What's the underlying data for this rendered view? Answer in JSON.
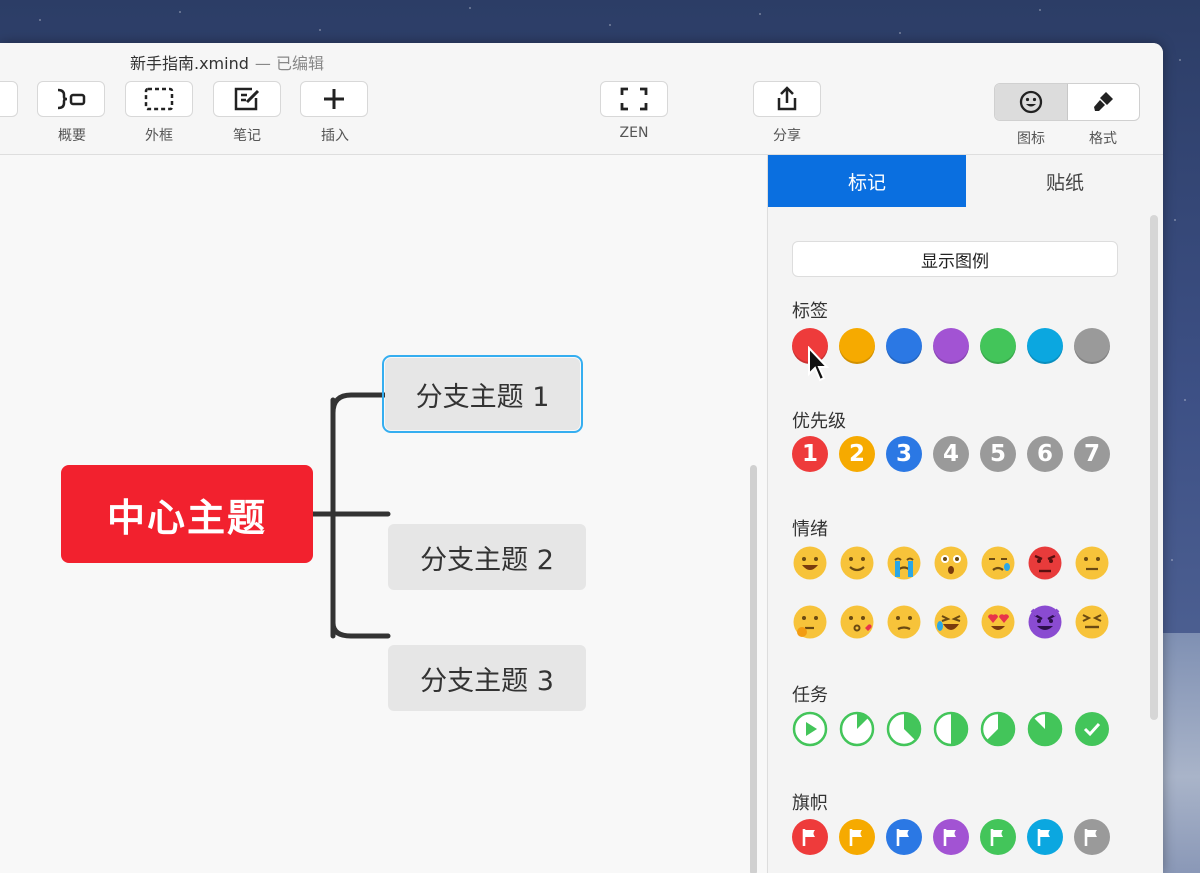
{
  "window": {
    "title": "新手指南.xmind",
    "status": "— 已编辑"
  },
  "toolbar": {
    "summary": "概要",
    "boundary": "外框",
    "notes": "笔记",
    "insert": "插入",
    "zen": "ZEN",
    "share": "分享",
    "icon_tab": "图标",
    "format_tab": "格式"
  },
  "mindmap": {
    "central": "中心主题",
    "branches": [
      "分支主题 1",
      "分支主题 2",
      "分支主题 3"
    ]
  },
  "panel": {
    "tabs": [
      "标记",
      "贴纸"
    ],
    "show_legend": "显示图例",
    "sections": {
      "tag": "标签",
      "priority": "优先级",
      "mood": "情绪",
      "task": "任务",
      "flag": "旗帜"
    },
    "tag_colors": [
      "#ee3b3b",
      "#f6aa00",
      "#2b78e4",
      "#a253d3",
      "#43c55a",
      "#0ba7e0",
      "#9a9a9a"
    ],
    "priority_items": [
      {
        "n": "1",
        "color": "#ee3b3b"
      },
      {
        "n": "2",
        "color": "#f6aa00"
      },
      {
        "n": "3",
        "color": "#2b78e4"
      },
      {
        "n": "4",
        "color": "#9a9a9a"
      },
      {
        "n": "5",
        "color": "#9a9a9a"
      },
      {
        "n": "6",
        "color": "#9a9a9a"
      },
      {
        "n": "7",
        "color": "#9a9a9a"
      }
    ],
    "mood_row1": [
      "grinning-face-icon",
      "smiling-face-icon",
      "crying-face-icon",
      "astonished-face-icon",
      "sad-tear-face-icon",
      "angry-face-icon",
      "neutral-face-icon"
    ],
    "mood_row2": [
      "thinking-face-icon",
      "kissing-face-icon",
      "confused-face-icon",
      "rofl-face-icon",
      "heart-eyes-face-icon",
      "devil-face-icon",
      "squint-face-icon"
    ],
    "task_progress": [
      0,
      0.125,
      0.375,
      0.5,
      0.625,
      0.875,
      1
    ],
    "flag_colors": [
      "#ee3b3b",
      "#f6aa00",
      "#2b78e4",
      "#a253d3",
      "#43c55a",
      "#0ba7e0",
      "#9a9a9a"
    ],
    "accent_color": "#0a6fe0",
    "task_color": "#43c55a"
  }
}
